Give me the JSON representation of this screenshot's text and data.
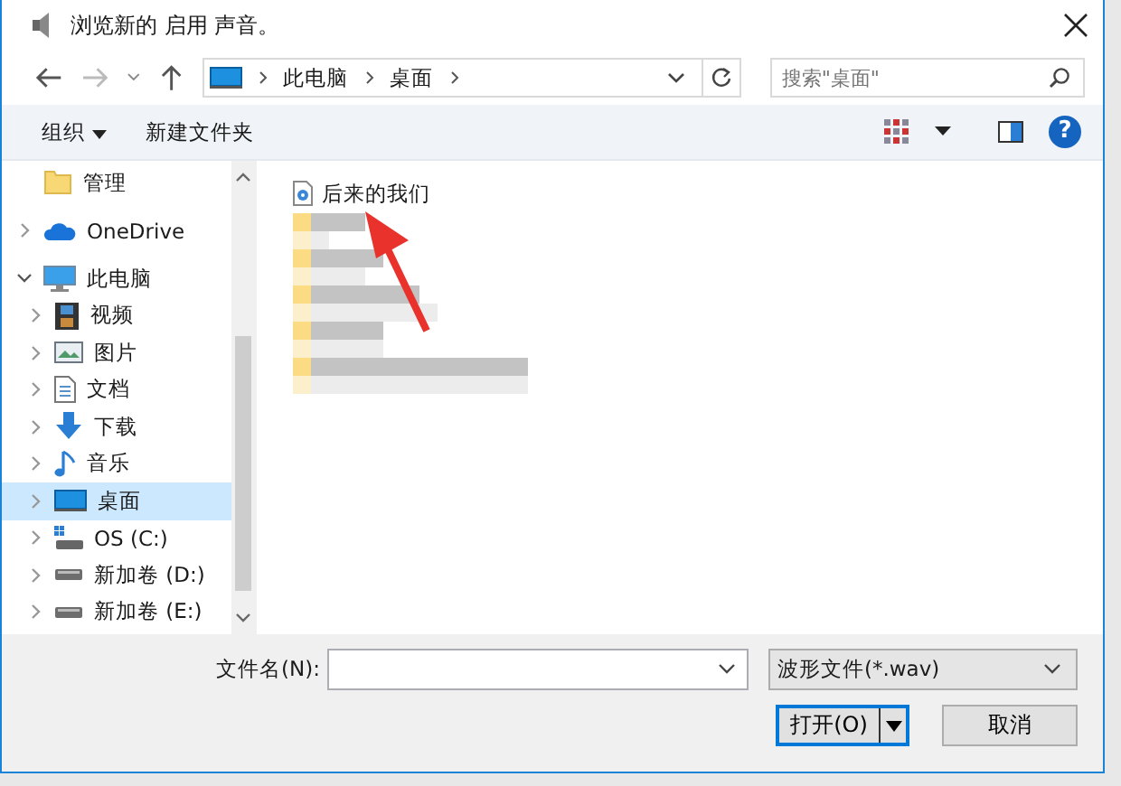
{
  "window": {
    "title": "浏览新的 启用 声音。"
  },
  "address": {
    "segments": [
      "此电脑",
      "桌面"
    ]
  },
  "search": {
    "placeholder": "搜索\"桌面\""
  },
  "toolbar": {
    "organize": "组织",
    "new_folder": "新建文件夹",
    "help": "?"
  },
  "nav_pane": {
    "items": [
      {
        "label": "管理",
        "kind": "folder",
        "selected": false
      },
      {
        "label": "OneDrive",
        "kind": "cloud",
        "expanded": false,
        "selected": false
      },
      {
        "label": "此电脑",
        "kind": "computer",
        "expanded": true,
        "selected": false,
        "children": [
          {
            "label": "视频",
            "kind": "video",
            "expanded": false,
            "selected": false
          },
          {
            "label": "图片",
            "kind": "pictures",
            "expanded": false,
            "selected": false
          },
          {
            "label": "文档",
            "kind": "document",
            "expanded": false,
            "selected": false
          },
          {
            "label": "下载",
            "kind": "download",
            "expanded": false,
            "selected": false
          },
          {
            "label": "音乐",
            "kind": "music",
            "expanded": false,
            "selected": false
          },
          {
            "label": "桌面",
            "kind": "desktop",
            "expanded": false,
            "selected": true
          },
          {
            "label": "OS (C:)",
            "kind": "system-drive",
            "expanded": false,
            "selected": false
          },
          {
            "label": "新加卷 (D:)",
            "kind": "drive",
            "expanded": false,
            "selected": false
          },
          {
            "label": "新加卷 (E:)",
            "kind": "drive",
            "expanded": false,
            "selected": false
          }
        ]
      }
    ]
  },
  "files": [
    {
      "name": "后来的我们"
    }
  ],
  "footer": {
    "filename_label": "文件名(N):",
    "filetype": "波形文件(*.wav)",
    "open": "打开(O)",
    "cancel": "取消"
  }
}
